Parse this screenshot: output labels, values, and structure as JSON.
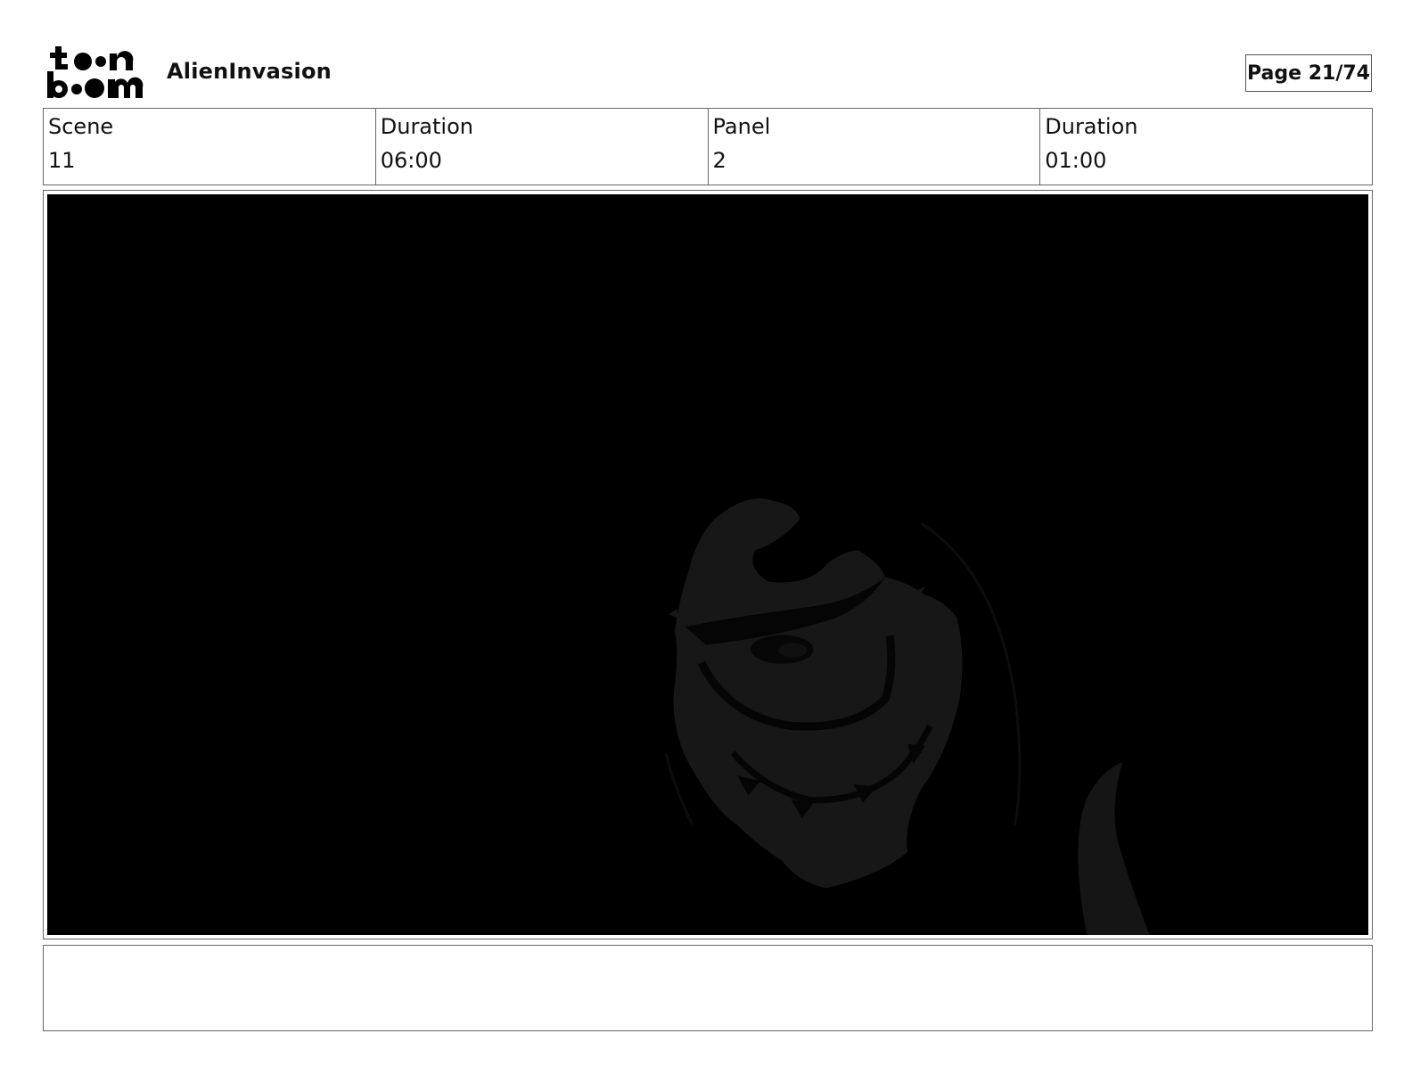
{
  "header": {
    "logo_icon": "toon-boom-logo",
    "project_title": "AlienInvasion",
    "page_label": "Page 21/74"
  },
  "info": {
    "scene_label": "Scene",
    "scene_value": "11",
    "scene_duration_label": "Duration",
    "scene_duration_value": "06:00",
    "panel_label": "Panel",
    "panel_value": "2",
    "panel_duration_label": "Duration",
    "panel_duration_value": "01:00"
  },
  "panel": {
    "image_subject": "dark-alien-creature-head",
    "background_color": "#000000",
    "figure_color": "#171717"
  },
  "notes": {
    "text": ""
  }
}
